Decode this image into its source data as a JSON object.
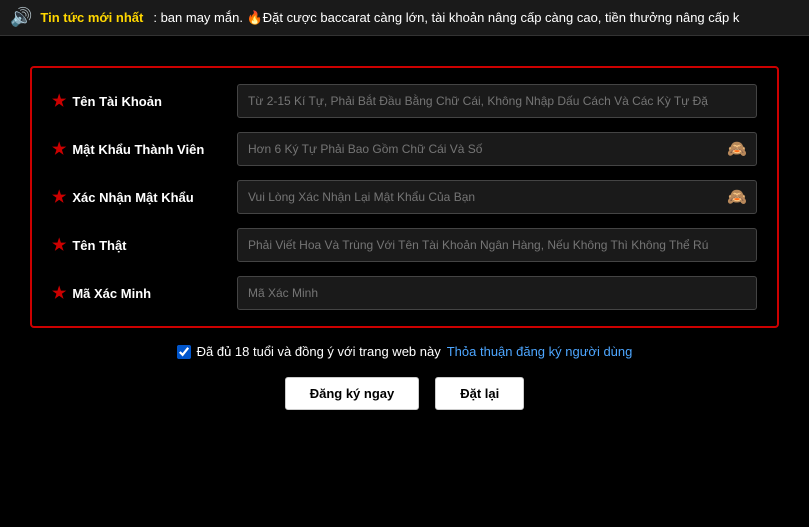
{
  "ticker": {
    "speaker": "🔊",
    "label": "Tin tức mới nhất",
    "text": " : ban may mắn. 🔥Đặt cược baccarat càng lớn, tài khoản nâng cấp càng cao, tiền thưởng nâng cấp k"
  },
  "form": {
    "fields": [
      {
        "id": "ten-tai-khoan",
        "label": "Tên Tài Khoản",
        "type": "text",
        "placeholder": "Từ 2-15 Kí Tự, Phải Bắt Đầu Bằng Chữ Cái, Không Nhập Dấu Cách Và Các Kỳ Tự Đặ",
        "hasEye": false
      },
      {
        "id": "mat-khau-thanh-vien",
        "label": "Mật Khẩu Thành Viên",
        "type": "password",
        "placeholder": "Hơn 6 Ký Tự Phải Bao Gồm Chữ Cái Và Số",
        "hasEye": true
      },
      {
        "id": "xac-nhan-mat-khau",
        "label": "Xác Nhận Mật Khẩu",
        "type": "password",
        "placeholder": "Vui Lòng Xác Nhận Lại Mật Khẩu Của Bạn",
        "hasEye": true
      },
      {
        "id": "ten-that",
        "label": "Tên Thật",
        "type": "text",
        "placeholder": "Phải Viết Hoa Và Trùng Với Tên Tài Khoản Ngân Hàng, Nếu Không Thì Không Thể Rú",
        "hasEye": false
      },
      {
        "id": "ma-xac-minh",
        "label": "Mã Xác Minh",
        "type": "text",
        "placeholder": "Mã Xác Minh",
        "hasEye": false
      }
    ],
    "checkbox_label": "Đã đủ 18 tuổi và đồng ý với trang web này",
    "link_label": "Thỏa thuận đăng ký người dùng",
    "btn_register": "Đăng ký ngay",
    "btn_reset": "Đặt lại"
  }
}
